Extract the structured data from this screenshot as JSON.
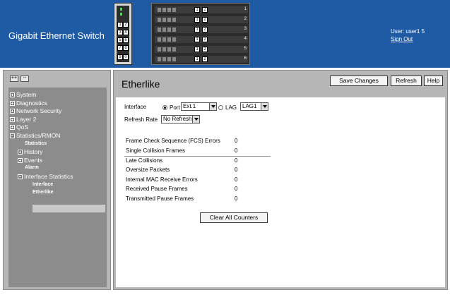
{
  "header": {
    "title": "Gigabit Ethernet Switch",
    "user_label": "User: user1 5",
    "signout": "Sign Out",
    "colors": {
      "header_bg": "#1f5aa5",
      "text": "#ffffff"
    }
  },
  "hardware": {
    "module_ports": [
      "1",
      "2",
      "3",
      "4",
      "5",
      "6",
      "7",
      "8",
      "9",
      "0"
    ],
    "chassis_rows": [
      {
        "ports": [
          "1",
          "2"
        ],
        "num": "1"
      },
      {
        "ports": [
          "1",
          "2"
        ],
        "num": "2"
      },
      {
        "ports": [
          "1",
          "2"
        ],
        "num": "3"
      },
      {
        "ports": [
          "1",
          "2"
        ],
        "num": "4"
      },
      {
        "ports": [
          "1",
          "2"
        ],
        "num": "5"
      },
      {
        "ports": [
          "1",
          "2"
        ],
        "num": "6"
      }
    ]
  },
  "sidebar": {
    "expand_btn": "++",
    "collapse_btn": "--",
    "items": [
      {
        "label": "System"
      },
      {
        "label": "Diagnostics"
      },
      {
        "label": "Network Security"
      },
      {
        "label": "Layer 2"
      },
      {
        "label": "QoS"
      },
      {
        "label": "Statistics/RMON"
      },
      {
        "label": "Statistics"
      },
      {
        "label": "History"
      },
      {
        "label": "Events"
      },
      {
        "label": "Alarm"
      },
      {
        "label": "Interface Statistics"
      },
      {
        "label": "Interface"
      },
      {
        "label": "Etherlike"
      }
    ]
  },
  "main": {
    "title": "Etherlike",
    "buttons": {
      "save": "Save Changes",
      "refresh": "Refresh",
      "help": "Help",
      "clear": "Clear All Counters"
    },
    "form": {
      "interface_label": "Interface",
      "port_label": "Port",
      "port_value": "Ext.1",
      "lag_label": "LAG",
      "lag_value": "LAG1",
      "refresh_label": "Refresh Rate",
      "refresh_value": "No Refresh"
    },
    "stats": [
      {
        "label": "Frame Check Sequence (FCS) Errors",
        "value": "0"
      },
      {
        "label": "Single Collision Frames",
        "value": "0"
      },
      {
        "label": "Late Collisions",
        "value": "0"
      },
      {
        "label": "Oversize Packets",
        "value": "0"
      },
      {
        "label": "Internal MAC Receive Errors",
        "value": "0"
      },
      {
        "label": "Received Pause Frames",
        "value": "0"
      },
      {
        "label": "Transmitted Pause Frames",
        "value": "0"
      }
    ]
  }
}
